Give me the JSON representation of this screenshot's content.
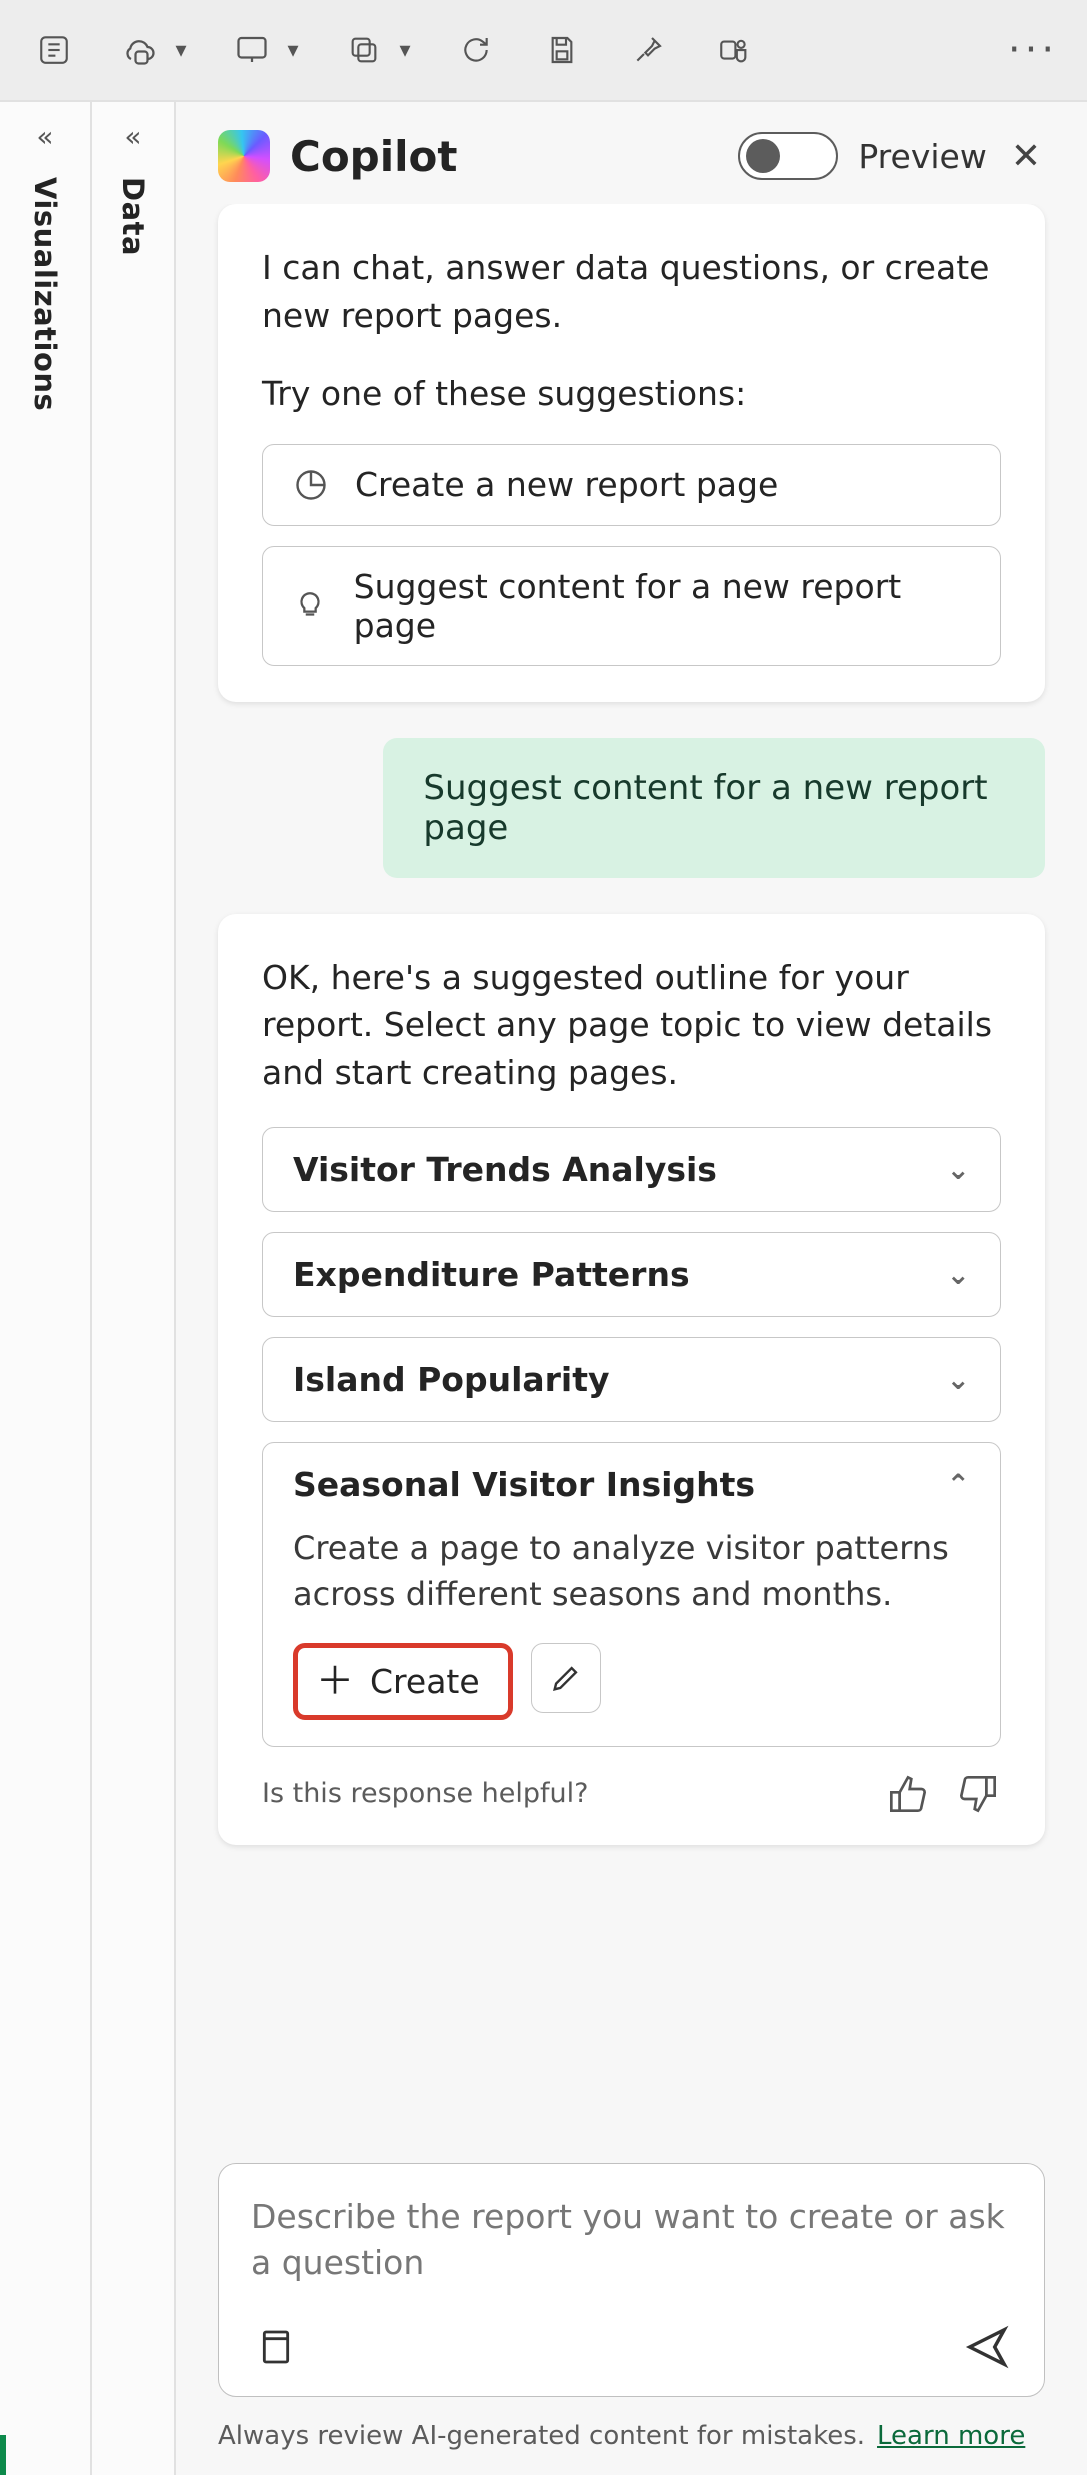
{
  "header": {
    "title": "Copilot",
    "preview_label": "Preview"
  },
  "rails": {
    "visualizations": "Visualizations",
    "data": "Data"
  },
  "intro": {
    "text": "I can chat, answer data questions, or create new report pages.",
    "try": "Try one of these suggestions:",
    "suggestions": [
      "Create a new report page",
      "Suggest content for a new report page"
    ]
  },
  "user_message": "Suggest content for a new report page",
  "assistant": {
    "text": "OK, here's a suggested outline for your report. Select any page topic to view details and start creating pages.",
    "topics": [
      {
        "title": "Visitor Trends Analysis",
        "expanded": false
      },
      {
        "title": "Expenditure Patterns",
        "expanded": false
      },
      {
        "title": "Island Popularity",
        "expanded": false
      },
      {
        "title": "Seasonal Visitor Insights",
        "expanded": true,
        "description": "Create a page to analyze visitor patterns across different seasons and months.",
        "create_label": "Create"
      }
    ],
    "feedback_prompt": "Is this response helpful?"
  },
  "input": {
    "placeholder": "Describe the report you want to create or ask a question"
  },
  "disclaimer": {
    "text": "Always review AI-generated content for mistakes.",
    "learn_more": "Learn more"
  }
}
